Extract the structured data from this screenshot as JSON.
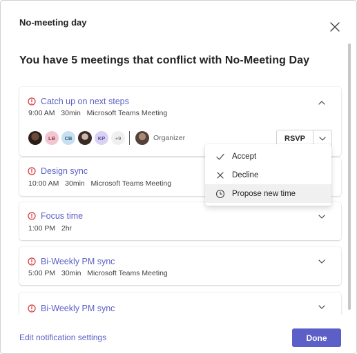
{
  "dialog": {
    "title": "No-meeting day",
    "heading": "You have 5 meetings that conflict with No-Meeting Day"
  },
  "meetings": [
    {
      "title": "Catch up on next steps",
      "time": "9:00 AM",
      "duration": "30min",
      "location": "Microsoft Teams Meeting",
      "expanded": true
    },
    {
      "title": "Design sync",
      "time": "10:00 AM",
      "duration": "30min",
      "location": "Microsoft Teams Meeting"
    },
    {
      "title": "Focus time",
      "time": "1:00 PM",
      "duration": "2hr",
      "location": ""
    },
    {
      "title": "Bi-Weekly PM sync",
      "time": "5:00 PM",
      "duration": "30min",
      "location": "Microsoft Teams Meeting"
    },
    {
      "title": "Bi-Weekly PM sync"
    }
  ],
  "attendees": {
    "initials": [
      "LB",
      "CB",
      "KP"
    ],
    "more": "+9",
    "organizer_label": "Organizer"
  },
  "rsvp": {
    "label": "RSVP",
    "menu": [
      {
        "label": "Accept",
        "icon": "check-icon"
      },
      {
        "label": "Decline",
        "icon": "x-icon"
      },
      {
        "label": "Propose new time",
        "icon": "clock-icon"
      }
    ]
  },
  "footer": {
    "settings_link": "Edit notification settings",
    "done_label": "Done"
  },
  "colors": {
    "accent": "#5b5fc7",
    "warning": "#d13438"
  }
}
